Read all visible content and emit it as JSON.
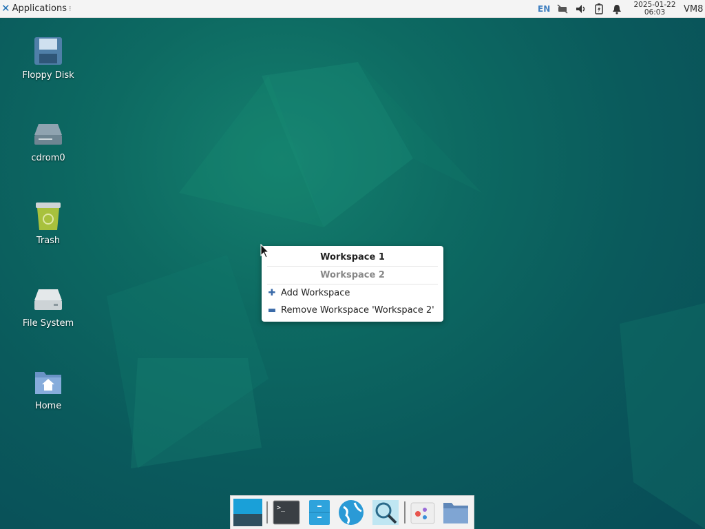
{
  "top_panel": {
    "applications_label": "Applications",
    "language": "EN",
    "clock": {
      "date": "2025-01-22",
      "time": "06:03"
    },
    "user": "VM8",
    "tray_icons": [
      "network-icon",
      "volume-icon",
      "battery-icon",
      "notification-bell-icon"
    ]
  },
  "desktop_icons": [
    {
      "label": "Floppy Disk",
      "icon": "floppy-disk-icon"
    },
    {
      "label": "cdrom0",
      "icon": "cdrom-drive-icon"
    },
    {
      "label": "Trash",
      "icon": "trash-icon"
    },
    {
      "label": "File System",
      "icon": "file-system-drive-icon"
    },
    {
      "label": "Home",
      "icon": "home-folder-icon"
    }
  ],
  "workspace_menu": {
    "workspaces": [
      {
        "label": "Workspace 1",
        "current": true
      },
      {
        "label": "Workspace 2",
        "current": false
      }
    ],
    "add_label": "Add Workspace",
    "remove_label": "Remove Workspace 'Workspace 2'"
  },
  "dock": {
    "items": [
      "show-desktop-icon",
      "terminal-icon",
      "file-manager-icon",
      "web-browser-icon",
      "search-icon",
      "settings-icon",
      "folder-icon"
    ]
  },
  "colors": {
    "panel_bg": "#f4f4f4",
    "desktop_bg": "#0a5a5c",
    "accent": "#3f7fc0"
  }
}
